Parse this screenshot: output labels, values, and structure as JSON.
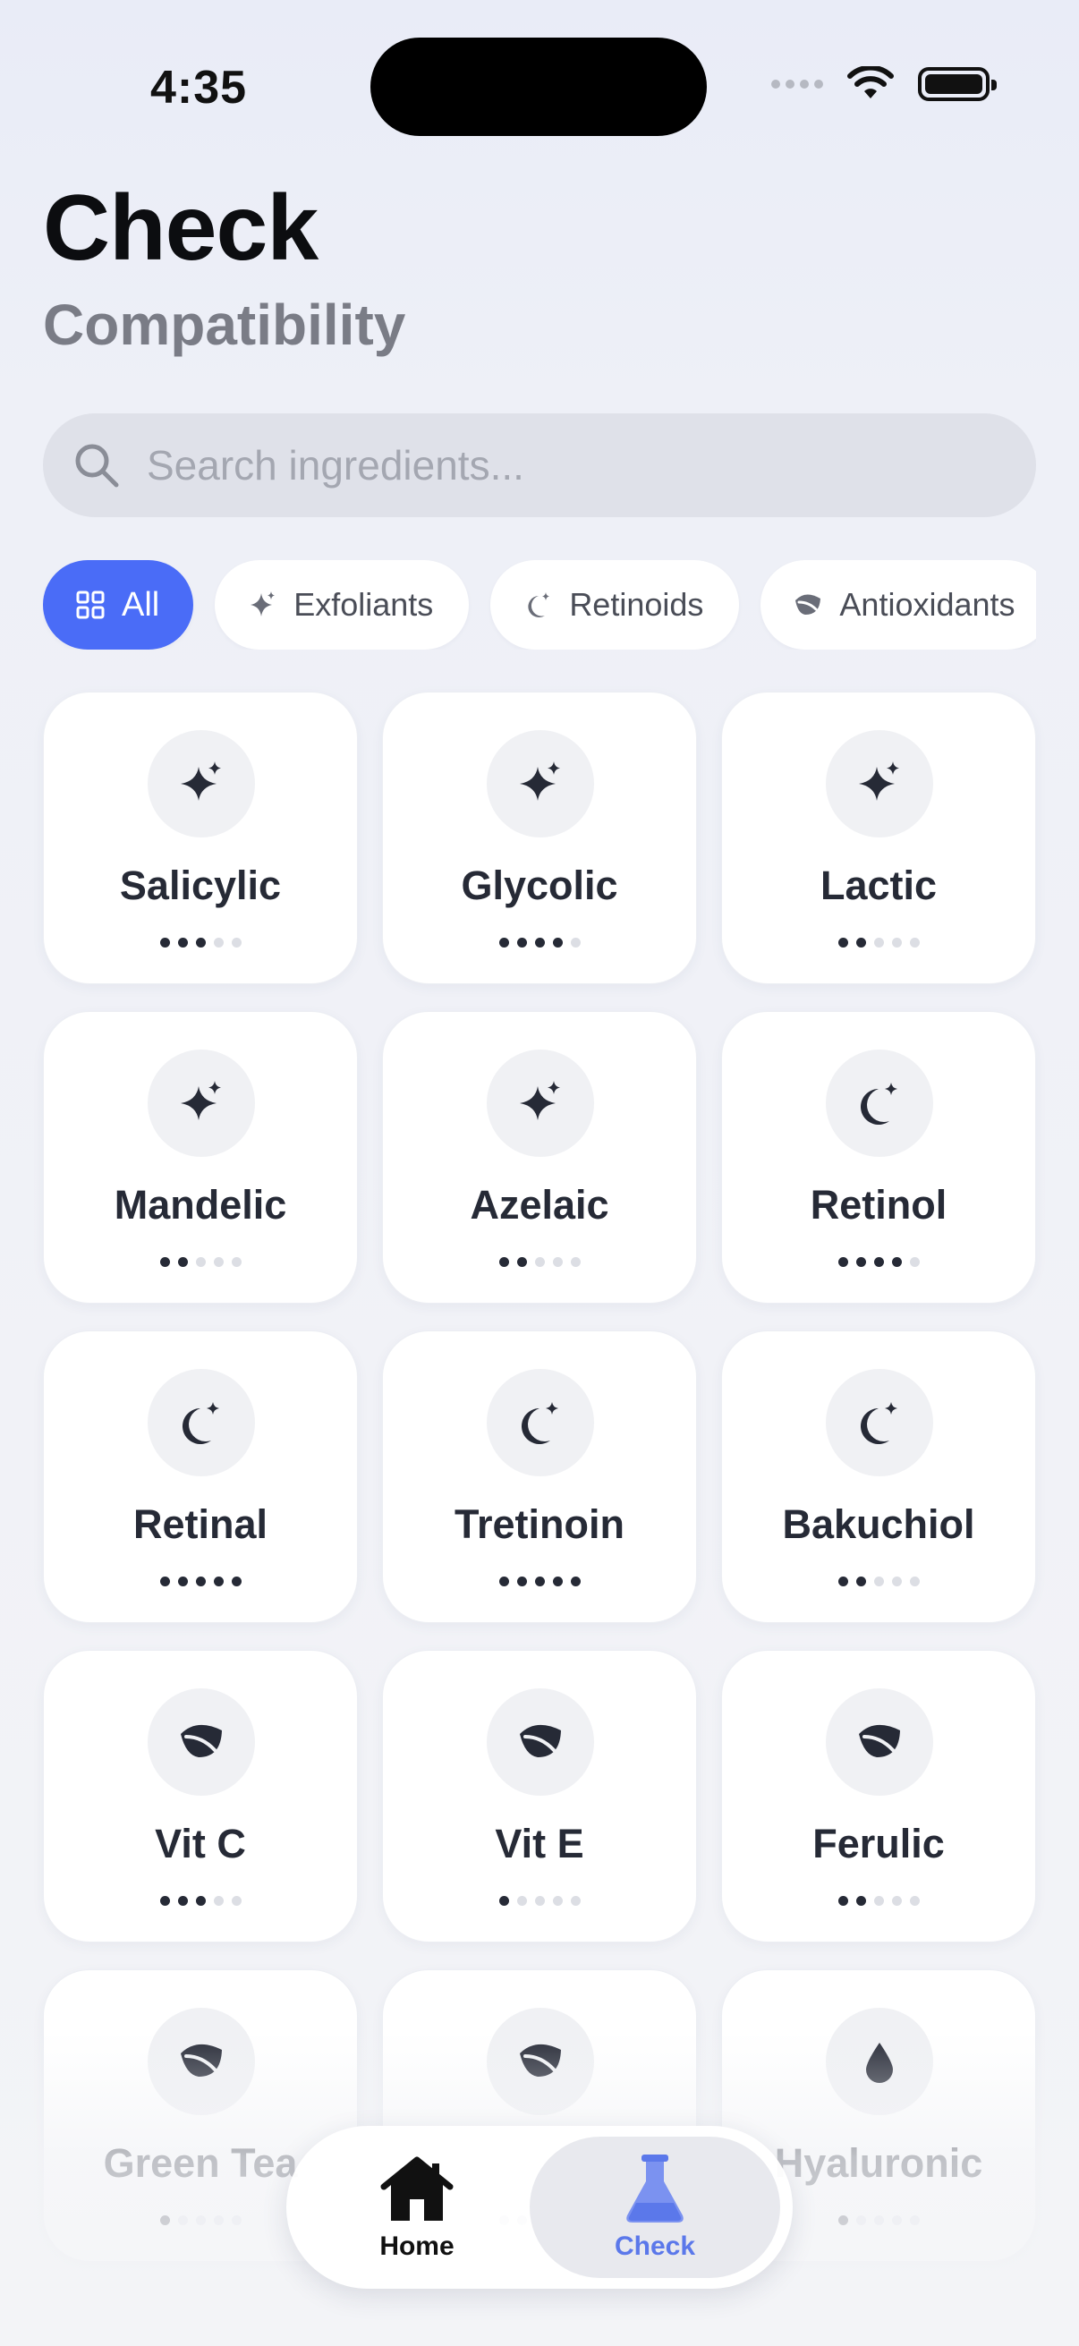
{
  "status": {
    "time": "4:35"
  },
  "header": {
    "title": "Check",
    "subtitle": "Compatibility"
  },
  "search": {
    "placeholder": "Search ingredients..."
  },
  "filters": [
    {
      "label": "All",
      "icon": "grid-icon",
      "active": true
    },
    {
      "label": "Exfoliants",
      "icon": "sparkle-icon",
      "active": false
    },
    {
      "label": "Retinoids",
      "icon": "moon-icon",
      "active": false
    },
    {
      "label": "Antioxidants",
      "icon": "leaf-icon",
      "active": false
    }
  ],
  "ingredients": [
    {
      "name": "Salicylic",
      "icon": "sparkle-icon",
      "strength": 3
    },
    {
      "name": "Glycolic",
      "icon": "sparkle-icon",
      "strength": 4
    },
    {
      "name": "Lactic",
      "icon": "sparkle-icon",
      "strength": 2
    },
    {
      "name": "Mandelic",
      "icon": "sparkle-icon",
      "strength": 2
    },
    {
      "name": "Azelaic",
      "icon": "sparkle-icon",
      "strength": 2
    },
    {
      "name": "Retinol",
      "icon": "moon-icon",
      "strength": 4
    },
    {
      "name": "Retinal",
      "icon": "moon-icon",
      "strength": 5
    },
    {
      "name": "Tretinoin",
      "icon": "moon-icon",
      "strength": 5
    },
    {
      "name": "Bakuchiol",
      "icon": "moon-icon",
      "strength": 2
    },
    {
      "name": "Vit C",
      "icon": "leaf-icon",
      "strength": 3
    },
    {
      "name": "Vit E",
      "icon": "leaf-icon",
      "strength": 1
    },
    {
      "name": "Ferulic",
      "icon": "leaf-icon",
      "strength": 2
    },
    {
      "name": "Green Tea",
      "icon": "leaf-icon",
      "strength": 1
    },
    {
      "name": "",
      "icon": "leaf-icon",
      "strength": 2
    },
    {
      "name": "Hyaluronic",
      "icon": "drop-icon",
      "strength": 1
    }
  ],
  "strength_max": 5,
  "tabbar": {
    "home": {
      "label": "Home",
      "icon": "house-icon"
    },
    "check": {
      "label": "Check",
      "icon": "flask-icon",
      "active": true
    }
  },
  "colors": {
    "accent": "#4a6cf7",
    "tab_active": "#5b78ea",
    "ink": "#262a36"
  }
}
